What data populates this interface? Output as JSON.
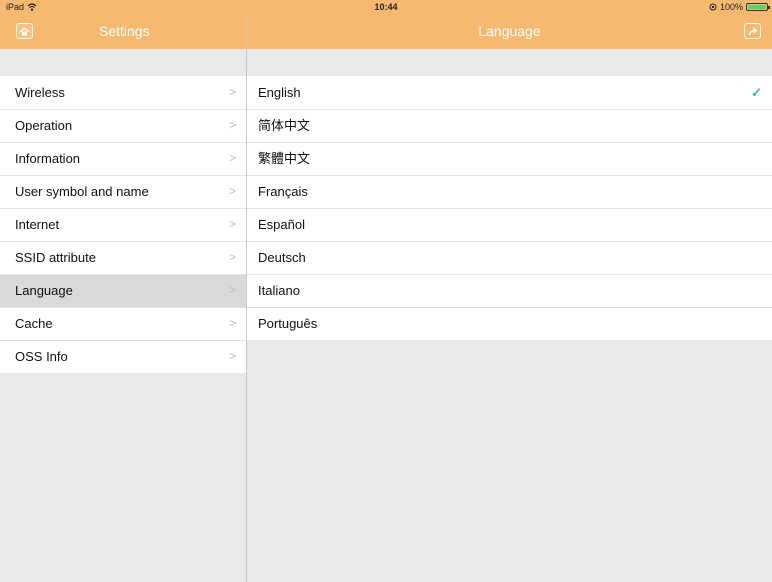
{
  "status_bar": {
    "device": "iPad",
    "time": "10:44",
    "battery": "100%"
  },
  "sidebar": {
    "title": "Settings",
    "items": [
      {
        "label": "Wireless"
      },
      {
        "label": "Operation"
      },
      {
        "label": "Information"
      },
      {
        "label": "User symbol and name"
      },
      {
        "label": "Internet"
      },
      {
        "label": "SSID attribute"
      },
      {
        "label": "Language",
        "selected": true
      },
      {
        "label": "Cache"
      },
      {
        "label": "OSS Info"
      }
    ]
  },
  "detail": {
    "title": "Language",
    "languages": [
      {
        "label": "English",
        "checked": true
      },
      {
        "label": "简体中文"
      },
      {
        "label": "繁體中文"
      },
      {
        "label": "Français"
      },
      {
        "label": "Español"
      },
      {
        "label": "Deutsch"
      },
      {
        "label": "Italiano"
      },
      {
        "label": "Português"
      }
    ]
  },
  "icons": {
    "home": "home-icon",
    "share": "share-icon",
    "wifi": "wifi-icon",
    "chevron": "chevron-right-icon",
    "check": "checkmark-icon"
  },
  "colors": {
    "header": "#f6b96f",
    "check": "#2cc2a6",
    "selected_row": "#d9d9d9",
    "background": "#e9e9e9"
  }
}
